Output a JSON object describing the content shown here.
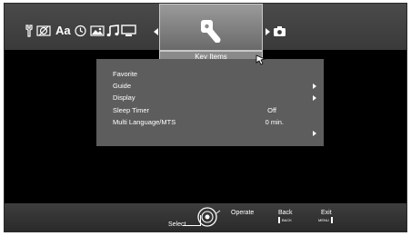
{
  "icons": [
    "wrench-icon",
    "no-image-icon",
    "text-icon",
    "clock-icon",
    "picture-icon",
    "music-note-icon",
    "monitor-icon",
    "key-items-icon",
    "camera-icon",
    "hand-pointer-icon",
    "remote-dpad-icon"
  ],
  "topbar": {
    "text_label": "Aa",
    "active_caption": "Key Items"
  },
  "menu": {
    "items": [
      {
        "label": "Favorite",
        "value": "",
        "arrow": false
      },
      {
        "label": "Guide",
        "value": "",
        "arrow": true
      },
      {
        "label": "Display",
        "value": "",
        "arrow": true
      },
      {
        "label": "Sleep Timer",
        "value": "Off",
        "arrow": false
      },
      {
        "label": "Multi Language/MTS",
        "value": "0 min.",
        "arrow": false
      },
      {
        "label": "",
        "value": "",
        "arrow": true
      }
    ]
  },
  "footer": {
    "select_label": "Select",
    "operate_label": "Operate",
    "back_label": "Back",
    "back_key": "BACK",
    "exit_label": "Exit",
    "exit_key": "MENU"
  }
}
